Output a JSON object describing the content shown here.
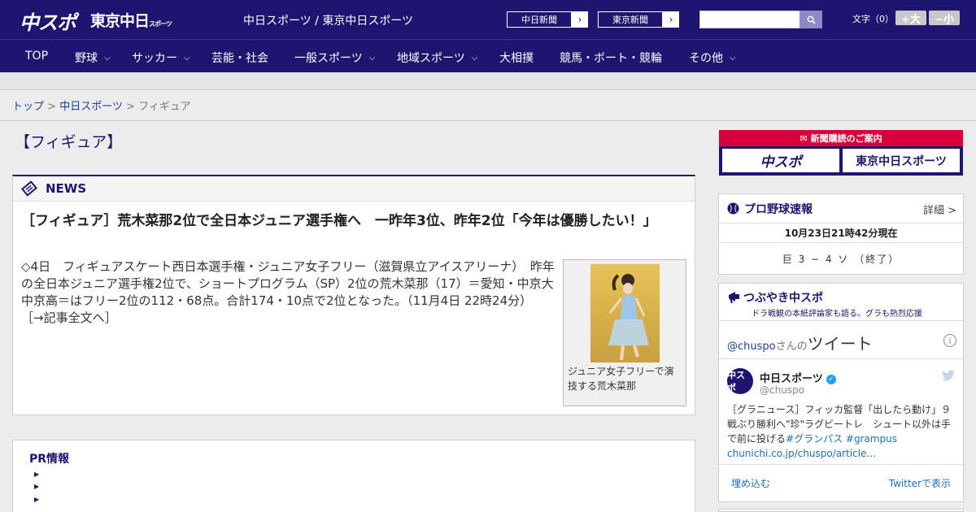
{
  "header": {
    "logo_main": "中スポ",
    "logo_tokyo": "東京中日",
    "logo_tokyo_small": "スポーツ",
    "site_title": "中日スポーツ / 東京中日スポーツ",
    "paper_buttons": [
      "中日新聞",
      "東京新聞"
    ],
    "search_placeholder": "",
    "fontsize_label": "文字（0）",
    "fontsize_up": "+大",
    "fontsize_down": "−小"
  },
  "nav": {
    "items": [
      "TOP",
      "野球",
      "サッカー",
      "芸能・社会",
      "一般スポーツ",
      "地域スポーツ",
      "大相撲",
      "競馬・ボート・競輪",
      "その他"
    ]
  },
  "breadcrumb": {
    "home": "トップ",
    "section": "中日スポーツ",
    "current": "フィギュア",
    "sep": ">"
  },
  "page_title": "【フィギュア】",
  "news": {
    "label": "NEWS",
    "headline": "［フィギュア］荒木菜那2位で全日本ジュニア選手権へ　一昨年3位、昨年2位「今年は優勝したい！」",
    "body": "◇4日　フィギュアスケート西日本選手権・ジュニア女子フリー（滋賀県立アイスアリーナ）　昨年の全日本ジュニア選手権2位で、ショートプログラム（SP）2位の荒木菜那（17）＝愛知・中京大中京高＝はフリー2位の112・68点。合計174・10点で2位となった。（11月4日 22時24分）",
    "more_link": "［→記事全文へ］",
    "photo_caption": "ジュニア女子フリーで演技する荒木菜那"
  },
  "pr": {
    "title": "PR情報"
  },
  "sidebar": {
    "subscription_title": "新聞購読のご案内",
    "subscription_buttons": [
      "中スポ",
      "東京中日スポーツ"
    ],
    "baseball_title": "プロ野球速報",
    "baseball_detail": "詳細 >",
    "baseball_time": "10月23日21時42分現在",
    "baseball_score": "巨 3 − 4 ソ （終了）",
    "twitter_title": "つぶやき中スポ",
    "twitter_sub": "ドラ戦観の本紙評論家も語る。グラも熱烈応援",
    "twitter_user_prefix": "@chuspo",
    "twitter_user_mid": "さんの",
    "twitter_user_suffix": "ツイート",
    "tweet_name": "中日スポーツ",
    "tweet_handle": "@chuspo",
    "tweet_text": "［グラニュース］フィッカ監督「出したら動け」９戦ぶり勝利へ\"珍\"ラグビートレ　シュート以外は手で前に投げる",
    "tweet_tags": "#グランパス #grampus",
    "tweet_link": "chunichi.co.jp/chuspo/article…",
    "embed": "埋め込む",
    "view_on_twitter": "Twitterで表示",
    "avatar_text": "中スポ"
  }
}
